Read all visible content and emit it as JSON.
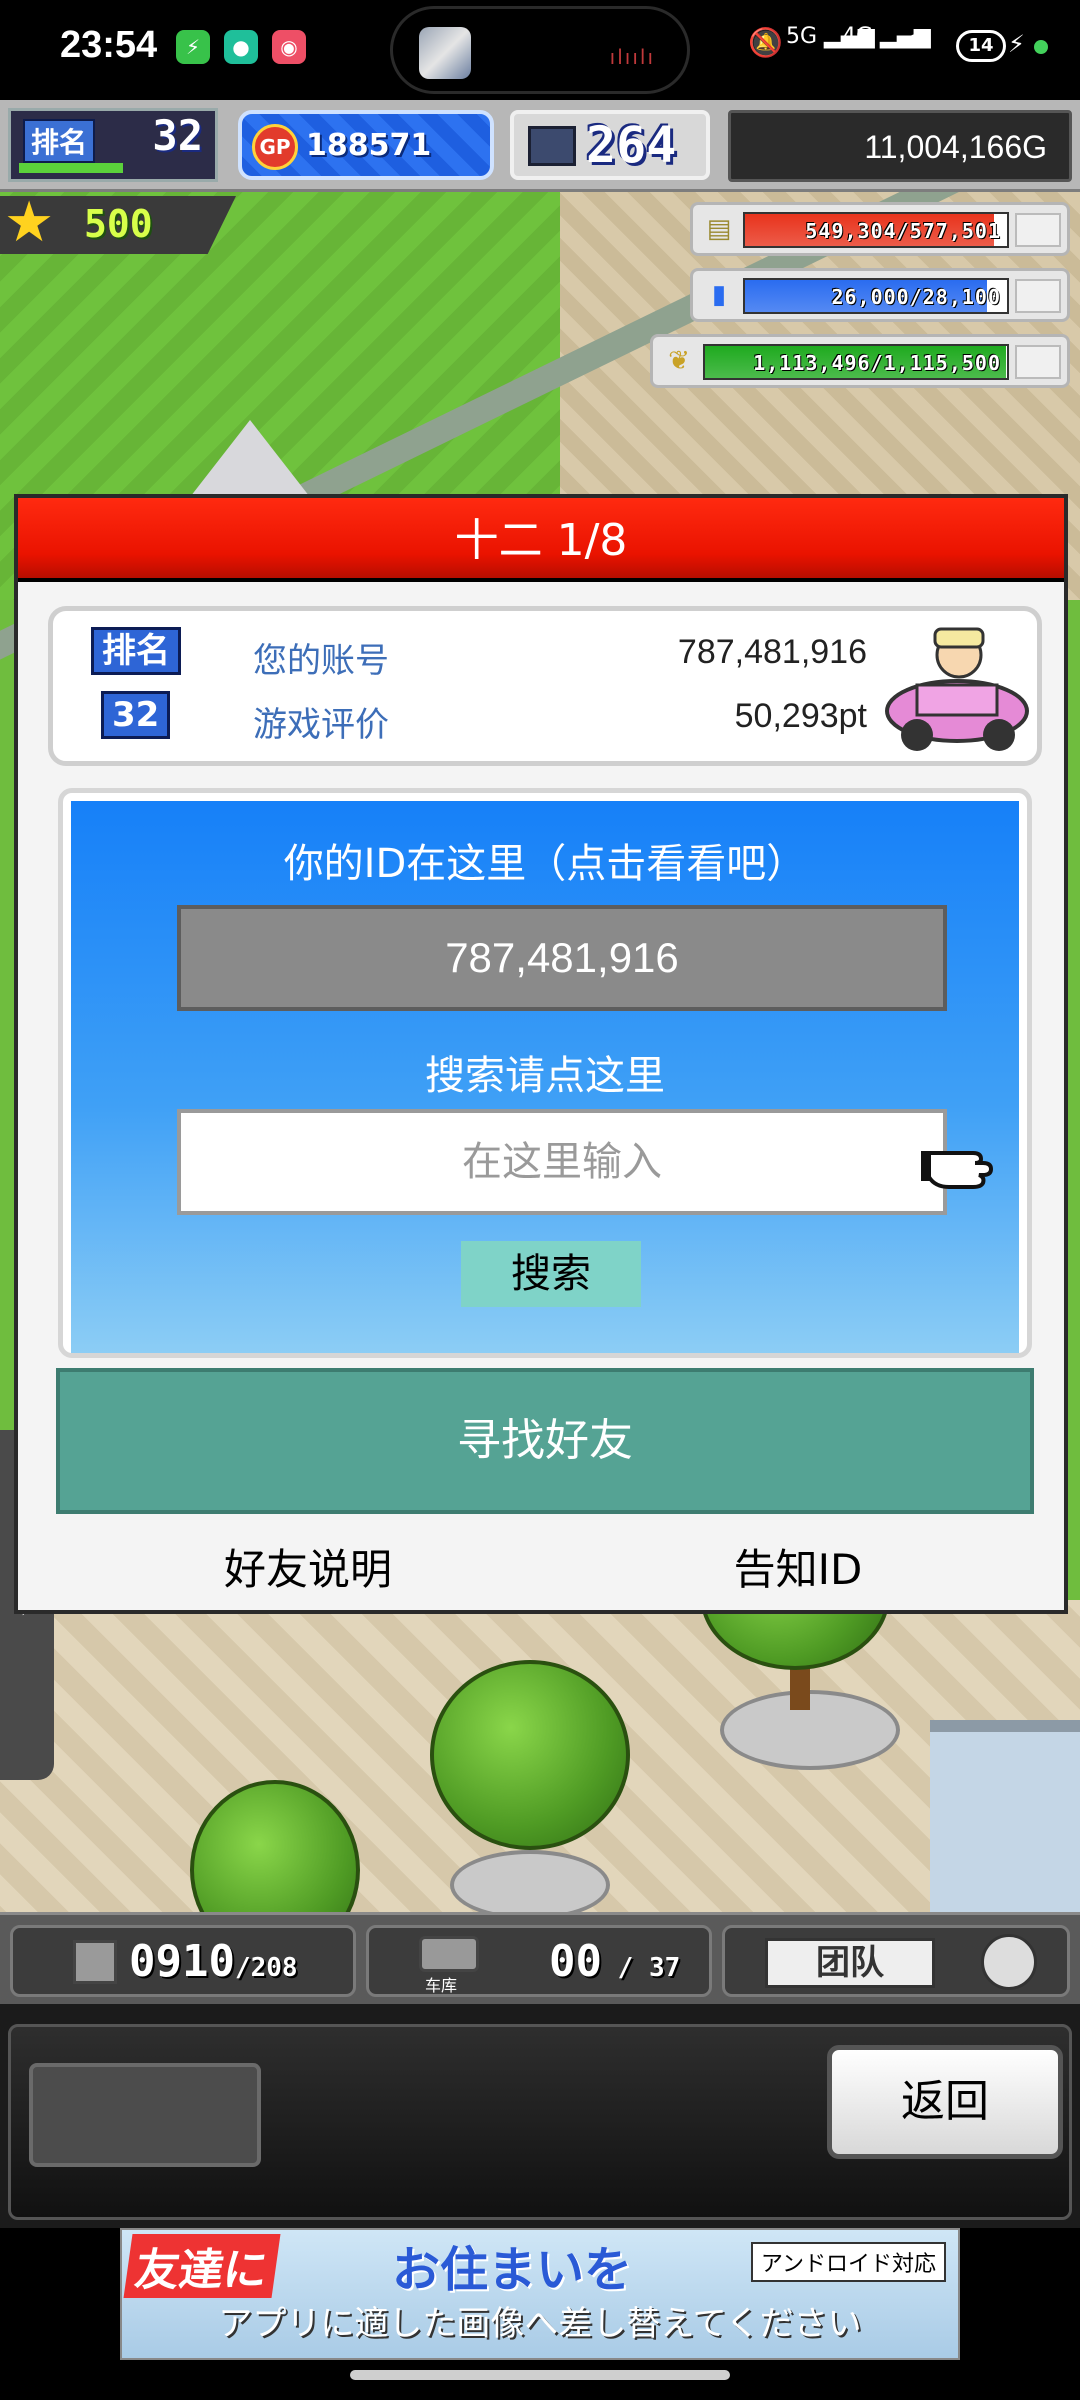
{
  "status_bar": {
    "time": "23:54",
    "battery": "14",
    "network_left": "5G",
    "network_right": "4G"
  },
  "hud": {
    "rank_label": "排名",
    "rank_value": "32",
    "gp_icon": "GP",
    "gp_value": "188571",
    "pc_value": "264",
    "money": "11,004,166G",
    "star_value": "500"
  },
  "resources": [
    {
      "icon": "coin-stack-icon",
      "text": "549,304/577,501",
      "fill": 0.951,
      "color": "#e8331c"
    },
    {
      "icon": "bottle-icon",
      "text": "26,000/28,100",
      "fill": 0.925,
      "color": "#2a6cf0"
    },
    {
      "icon": "wheat-icon",
      "text": "1,113,496/1,115,500",
      "fill": 0.998,
      "color": "#1faa1f"
    }
  ],
  "dialog": {
    "title": "十二 1/8",
    "rank_badge": "排名",
    "rank_number": "32",
    "account_label": "您的账号",
    "account_value": "787,481,916",
    "rating_label": "游戏评价",
    "rating_value": "50,293pt",
    "id_title": "你的ID在这里（点击看看吧）",
    "id_value": "787,481,916",
    "search_hint": "搜索请点这里",
    "search_placeholder": "在这里输入",
    "search_button": "搜索",
    "find_friend_button": "寻找好友",
    "friend_info_link": "好友说明",
    "notify_id_link": "告知ID"
  },
  "bottom_hud": {
    "lot_count": "0910",
    "lot_total": "208",
    "garage_label": "车库",
    "garage_count": "00",
    "garage_total": "37",
    "team_label": "团队",
    "back_button": "返回"
  },
  "ad": {
    "title_a": "友達に",
    "title_b": "お住まいを",
    "tag": "アンドロイド対応",
    "note": "アプリに適した画像へ差し替えてください"
  }
}
